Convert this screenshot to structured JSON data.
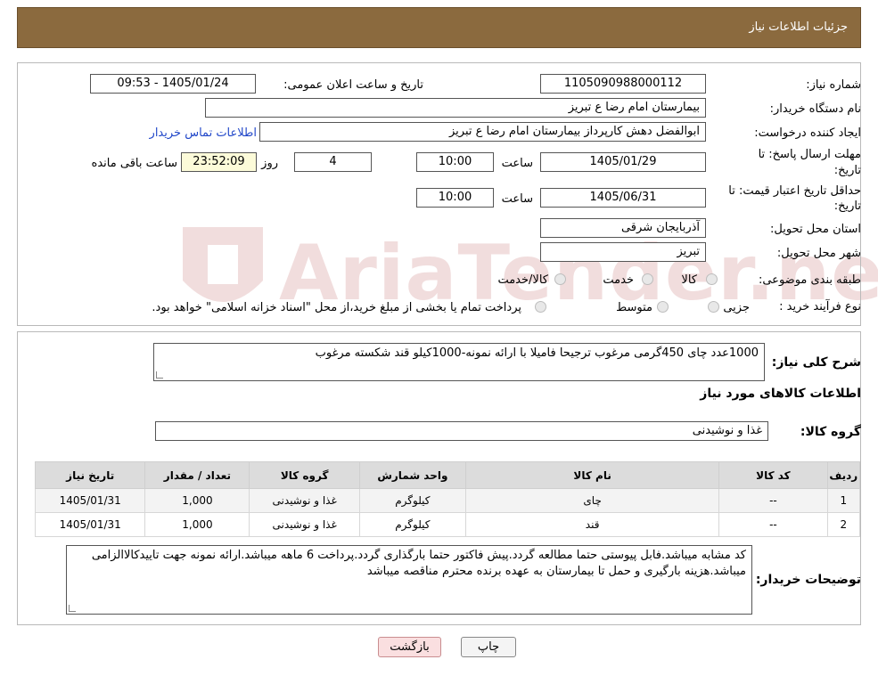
{
  "header": {
    "title": "جزئیات اطلاعات نیاز"
  },
  "form": {
    "need_number_label": "شماره نیاز:",
    "need_number": "1105090988000112",
    "announce_label": "تاریخ و ساعت اعلان عمومی:",
    "announce_value": "1405/01/24 - 09:53",
    "buyer_org_label": "نام دستگاه خریدار:",
    "buyer_org": "بیمارستان امام رضا  ع  تبریز",
    "requester_label": "ایجاد کننده درخواست:",
    "requester": "ابوالفضل دهش کارپرداز بیمارستان امام رضا  ع  تبریز",
    "contact_link": "اطلاعات تماس خریدار",
    "deadline_label_1": "مهلت ارسال پاسخ: تا",
    "deadline_label_2": "تاریخ:",
    "deadline_date": "1405/01/29",
    "time_label": "ساعت",
    "deadline_time": "10:00",
    "days_value": "4",
    "days_label": "روز و",
    "remaining_time": "23:52:09",
    "remaining_label": "ساعت باقی مانده",
    "validity_label_1": "حداقل تاریخ اعتبار قیمت: تا",
    "validity_label_2": "تاریخ:",
    "validity_date": "1405/06/31",
    "validity_time": "10:00",
    "province_label": "استان محل تحویل:",
    "province": "آذربایجان شرقی",
    "city_label": "شهر محل تحویل:",
    "city": "تبریز",
    "category_label": "طبقه بندی موضوعی:",
    "category_options": [
      "کالا",
      "خدمت",
      "کالا/خدمت"
    ],
    "process_label": "نوع فرآیند خرید :",
    "process_options": [
      "جزیی",
      "متوسط"
    ],
    "process_note": "پرداخت تمام یا بخشی از مبلغ خرید،از محل \"اسناد خزانه اسلامی\" خواهد بود."
  },
  "need": {
    "summary_label": "شرح کلی نیاز:",
    "summary": "1000عدد چای 450گرمی مرغوب ترجیحا فامیلا با ارائه نمونه-1000کیلو قند شکسته مرغوب",
    "goods_info_title": "اطلاعات کالاهای مورد نیاز",
    "goods_group_label": "گروه کالا:",
    "goods_group": "غذا و نوشیدنی"
  },
  "table": {
    "headers": [
      "ردیف",
      "کد کالا",
      "نام کالا",
      "واحد شمارش",
      "گروه کالا",
      "تعداد / مقدار",
      "تاریخ نیاز"
    ],
    "rows": [
      [
        "1",
        "--",
        "چای",
        "کیلوگرم",
        "غذا و نوشیدنی",
        "1,000",
        "1405/01/31"
      ],
      [
        "2",
        "--",
        "قند",
        "کیلوگرم",
        "غذا و نوشیدنی",
        "1,000",
        "1405/01/31"
      ]
    ]
  },
  "buyer_notes": {
    "label": "توضیحات خریدار:",
    "text": "کد مشابه میباشد.فابل پیوستی حتما مطالعه گردد.پیش فاکتور حتما بارگذاری گردد.پرداخت 6 ماهه میباشد.ارائه نمونه جهت تاییدکالاالزامی میباشد.هزینه بارگیری و حمل تا بیمارستان به عهده برنده محترم مناقصه میباشد"
  },
  "buttons": {
    "print": "چاپ",
    "back": "بازگشت"
  },
  "watermark": {
    "text": "AriaTender.neT",
    "color": "#9a0000"
  },
  "colors": {
    "header_bg": "#8b6a3e",
    "link": "#2147c9",
    "back_button": "#fadfe0"
  }
}
